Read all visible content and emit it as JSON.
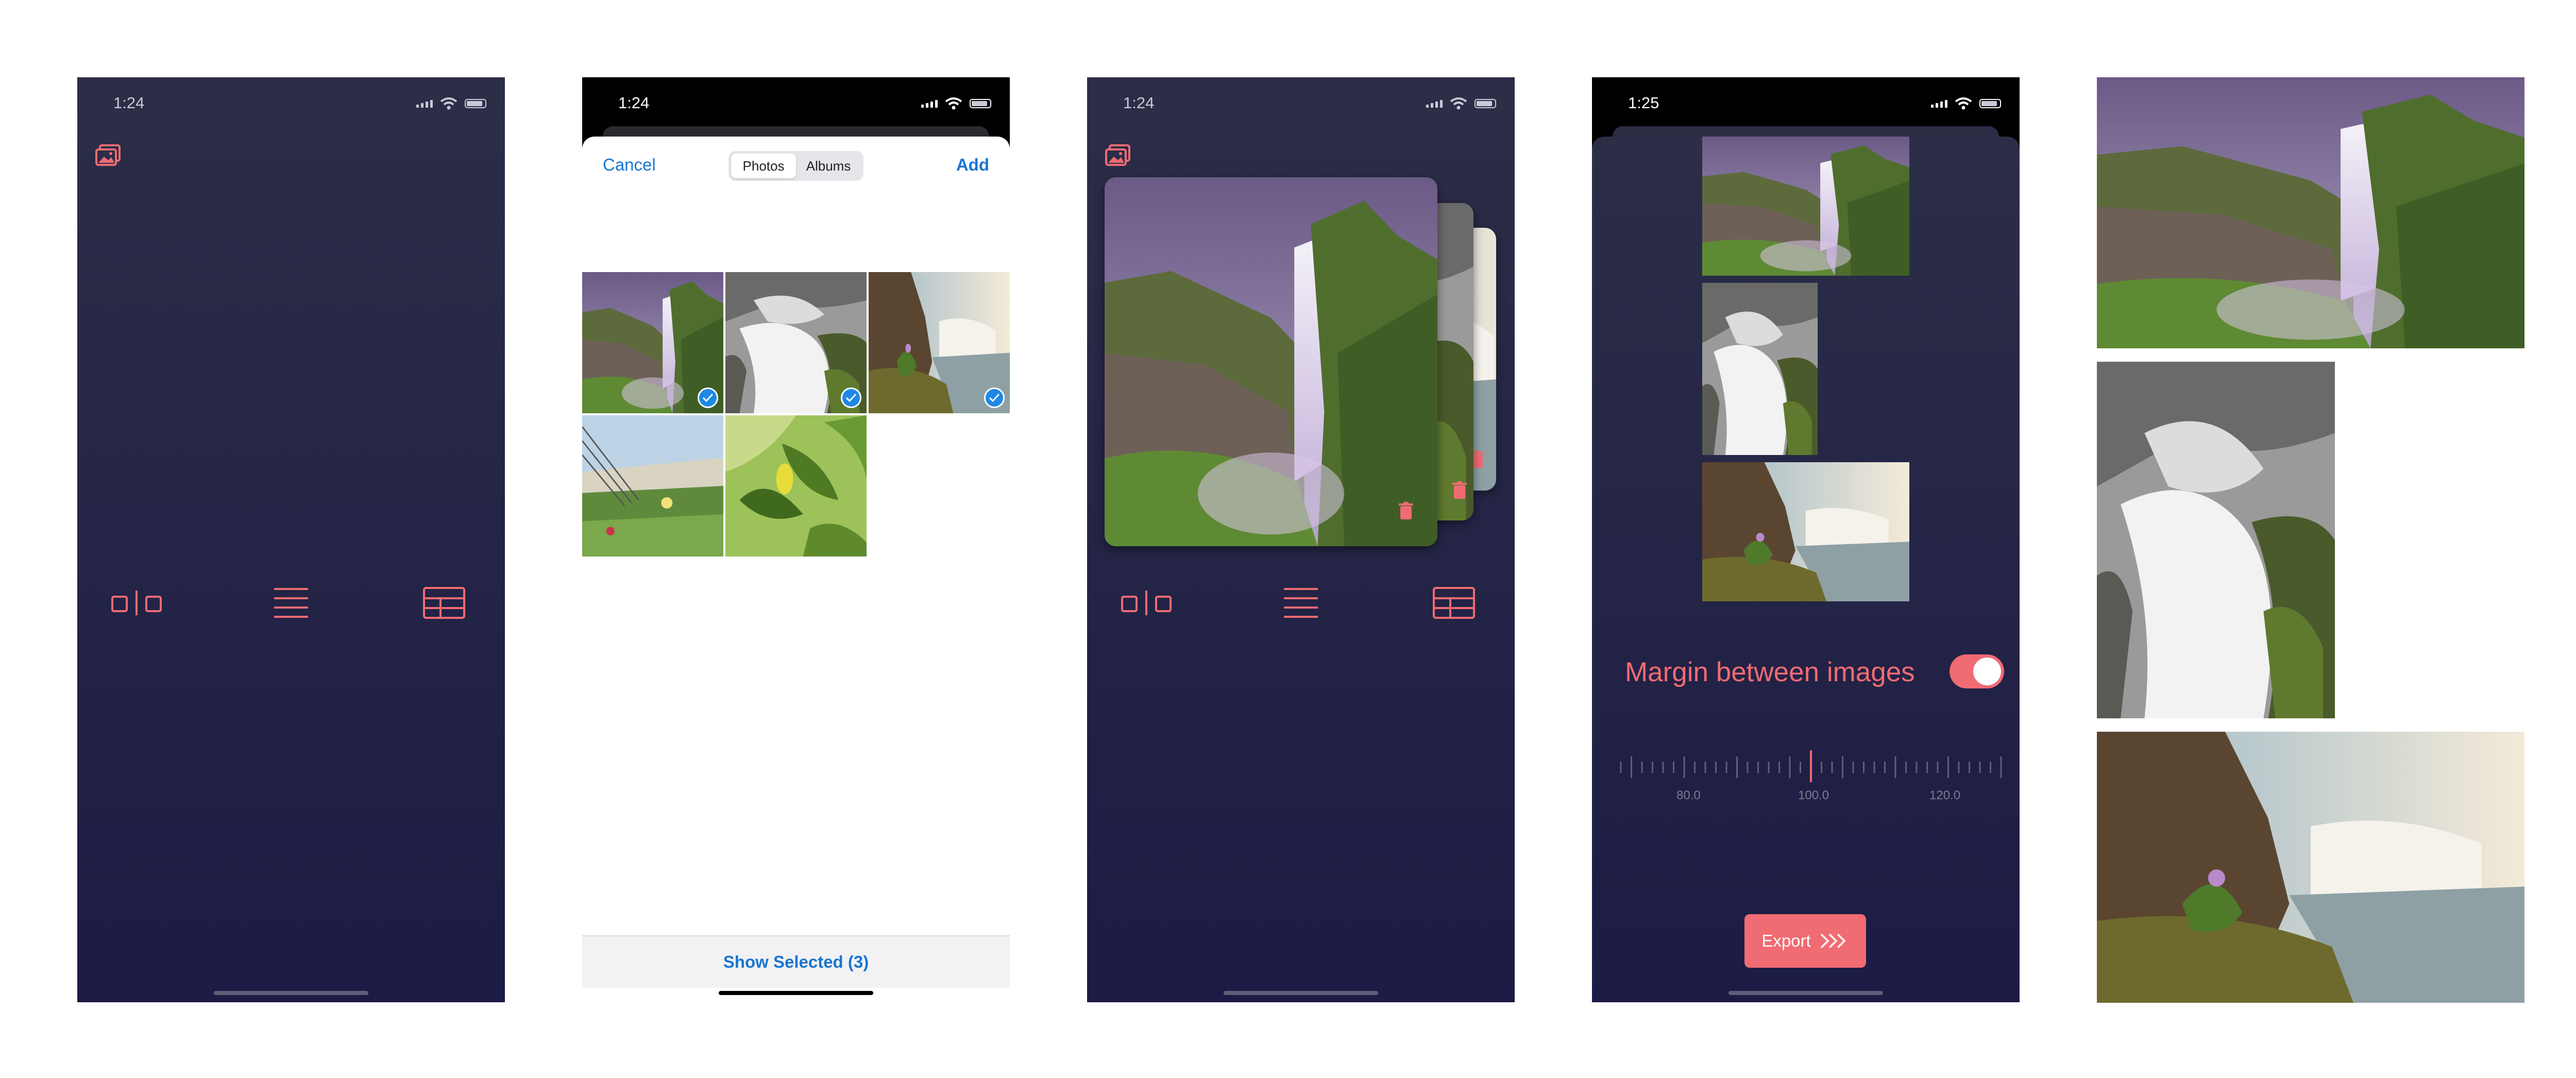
{
  "screen1": {
    "time": "1:24",
    "icons": [
      "gallery-icon",
      "side-by-side-layout-icon",
      "list-layout-icon",
      "grid-layout-icon"
    ]
  },
  "screen2": {
    "time": "1:24",
    "cancel_label": "Cancel",
    "add_label": "Add",
    "segments": [
      "Photos",
      "Albums"
    ],
    "active_segment": "Photos",
    "photos": [
      {
        "name": "waterfall-canyon",
        "selected": true
      },
      {
        "name": "waterfall-rocks-bw",
        "selected": true
      },
      {
        "name": "waterfall-coast",
        "selected": true
      },
      {
        "name": "beach-grass",
        "selected": false
      },
      {
        "name": "lemon-tree",
        "selected": false
      }
    ],
    "show_selected_label": "Show Selected (3)"
  },
  "screen3": {
    "time": "1:24",
    "icons": [
      "gallery-icon",
      "trash-icon",
      "side-by-side-layout-icon",
      "list-layout-icon",
      "grid-layout-icon"
    ]
  },
  "screen4": {
    "time": "1:25",
    "margin_label": "Margin between images",
    "margin_toggle_on": true,
    "ruler_labels": [
      "80.0",
      "100.0",
      "120.0"
    ],
    "ruler_selected": "100.0",
    "export_label": "Export"
  },
  "colors": {
    "accent": "#f06b72",
    "background_top": "#2c2e47",
    "background_bottom": "#1c1b45",
    "link_blue": "#1976d2"
  }
}
